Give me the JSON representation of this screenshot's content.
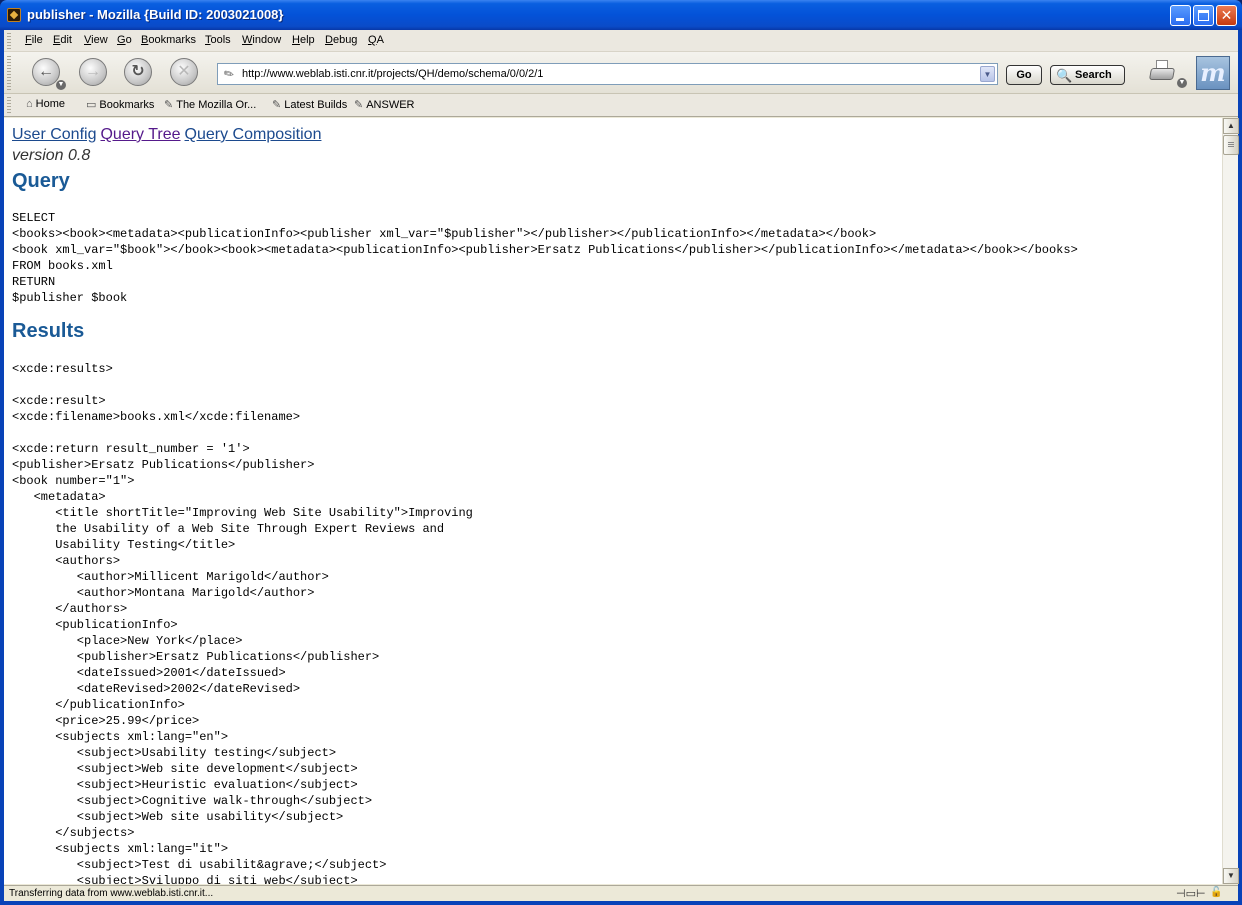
{
  "window": {
    "title": "publisher - Mozilla {Build ID: 2003021008}"
  },
  "menu": [
    "File",
    "Edit",
    "View",
    "Go",
    "Bookmarks",
    "Tools",
    "Window",
    "Help",
    "Debug",
    "QA"
  ],
  "navbar": {
    "url": "http://www.weblab.isti.cnr.it/projects/QH/demo/schema/0/0/2/1",
    "go_label": "Go",
    "search_label": "Search"
  },
  "personal_toolbar": [
    "Home",
    "Bookmarks",
    "The Mozilla Or...",
    "Latest Builds",
    "ANSWER"
  ],
  "page": {
    "links": [
      "User Config",
      "Query Tree",
      "Query Composition"
    ],
    "version": "version 0.8",
    "query_heading": "Query",
    "query_lines": [
      "SELECT",
      "<books><book><metadata><publicationInfo><publisher xml_var=\"$publisher\"></publisher></publicationInfo></metadata></book>",
      "<book xml_var=\"$book\"></book><book><metadata><publicationInfo><publisher>Ersatz Publications</publisher></publicationInfo></metadata></book></books>",
      "FROM books.xml",
      "RETURN",
      "$publisher $book"
    ],
    "results_heading": "Results",
    "results_lines": [
      "<xcde:results>",
      "",
      "<xcde:result>",
      "<xcde:filename>books.xml</xcde:filename>",
      "",
      "<xcde:return result_number = '1'>",
      "<publisher>Ersatz Publications</publisher>",
      "<book number=\"1\">",
      "   <metadata>",
      "      <title shortTitle=\"Improving Web Site Usability\">Improving",
      "      the Usability of a Web Site Through Expert Reviews and",
      "      Usability Testing</title>",
      "      <authors>",
      "         <author>Millicent Marigold</author>",
      "         <author>Montana Marigold</author>",
      "      </authors>",
      "      <publicationInfo>",
      "         <place>New York</place>",
      "         <publisher>Ersatz Publications</publisher>",
      "         <dateIssued>2001</dateIssued>",
      "         <dateRevised>2002</dateRevised>",
      "      </publicationInfo>",
      "      <price>25.99</price>",
      "      <subjects xml:lang=\"en\">",
      "         <subject>Usability testing</subject>",
      "         <subject>Web site development</subject>",
      "         <subject>Heuristic evaluation</subject>",
      "         <subject>Cognitive walk-through</subject>",
      "         <subject>Web site usability</subject>",
      "      </subjects>",
      "      <subjects xml:lang=\"it\">",
      "         <subject>Test di usabilit&agrave;</subject>",
      "         <subject>Sviluppo di siti web</subject>"
    ]
  },
  "status": {
    "text": "Transferring data from www.weblab.isti.cnr.it..."
  },
  "icons": {
    "back": "back-arrow-icon",
    "forward": "forward-arrow-icon",
    "reload": "reload-icon",
    "stop": "stop-icon",
    "print": "print-icon",
    "throbber": "mozilla-logo-icon"
  },
  "colors": {
    "titlebar": "#0452d8",
    "heading": "#1a5a96",
    "link": "#1c4a8e",
    "visited_link": "#551a8b"
  }
}
